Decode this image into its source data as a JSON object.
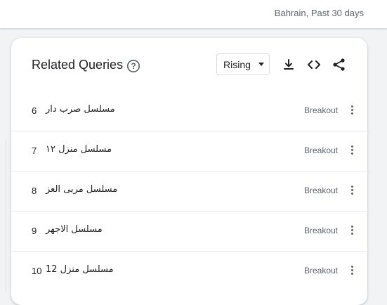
{
  "header": {
    "filter_text": "Bahrain, Past 30 days"
  },
  "card": {
    "title": "Related Queries",
    "help_icon": "help-circle-icon",
    "dropdown": {
      "selected": "Rising"
    },
    "tools": [
      "download-icon",
      "embed-code-icon",
      "share-icon"
    ]
  },
  "rows": [
    {
      "rank": "6",
      "query": "مسلسل صرب دار",
      "status": "Breakout"
    },
    {
      "rank": "7",
      "query": "مسلسل منزل ١٢",
      "status": "Breakout"
    },
    {
      "rank": "8",
      "query": "مسلسل مربى العز",
      "status": "Breakout"
    },
    {
      "rank": "9",
      "query": "مسلسل الاجهر",
      "status": "Breakout"
    },
    {
      "rank": "10",
      "query": "مسلسل منزل 12",
      "status": "Breakout"
    }
  ],
  "colors": {
    "accent": "#1a73e8",
    "text": "#202124",
    "muted": "#5f6368"
  }
}
